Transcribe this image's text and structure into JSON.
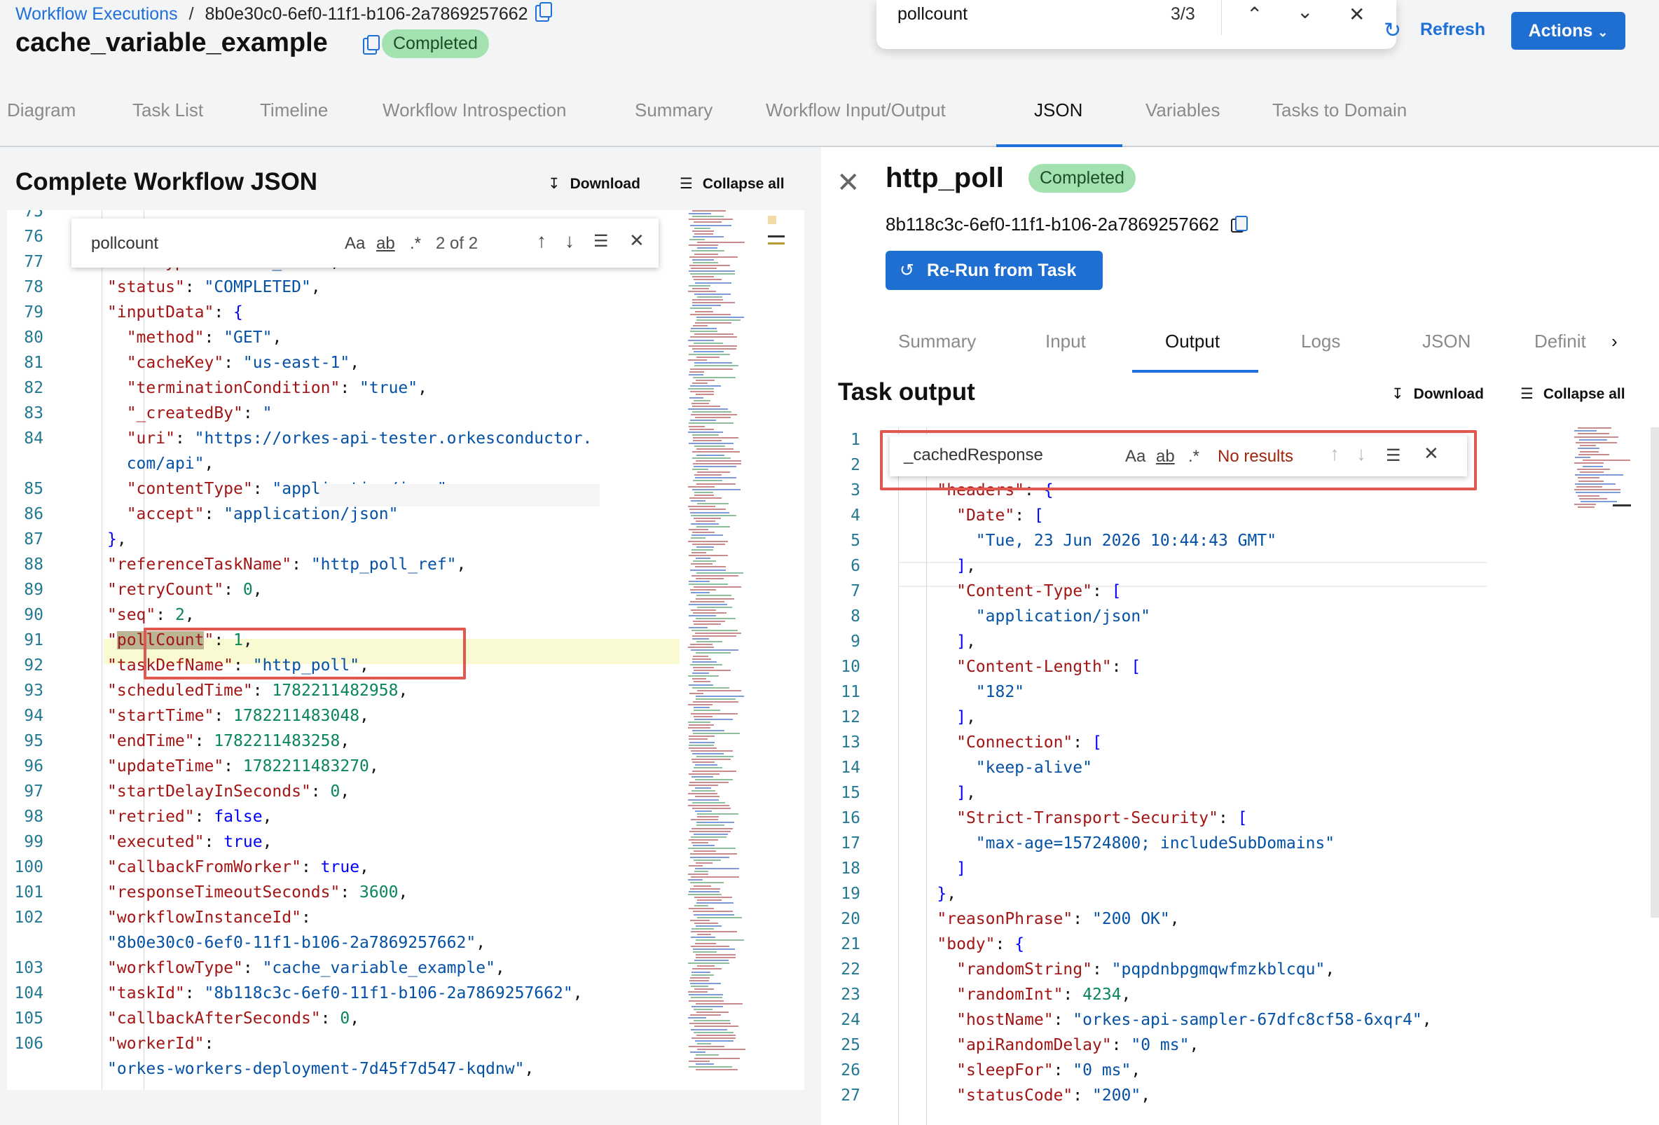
{
  "breadcrumb": {
    "root": "Workflow Executions",
    "separator": "/",
    "execution_id": "8b0e30c0-6ef0-11f1-b106-2a7869257662"
  },
  "workflow": {
    "name": "cache_variable_example",
    "status": "Completed"
  },
  "browser_find": {
    "query": "pollcount",
    "count": "3/3"
  },
  "header_actions": {
    "refresh": "Refresh",
    "actions": "Actions"
  },
  "tabs": [
    "Diagram",
    "Task List",
    "Timeline",
    "Workflow Introspection",
    "Summary",
    "Workflow Input/Output",
    "JSON",
    "Variables",
    "Tasks to Domain"
  ],
  "active_tab": "JSON",
  "left": {
    "title": "Complete Workflow JSON",
    "download": "Download",
    "collapse": "Collapse all",
    "find": {
      "query": "pollcount",
      "count": "2 of 2",
      "match_case": "Aa",
      "whole_word": "ab",
      "regex": ".*"
    },
    "lines": [
      {
        "no": "75",
        "tokens": []
      },
      {
        "no": "76",
        "tokens": []
      },
      {
        "no": "77",
        "tokens": [
          [
            "k",
            "\"taskType\""
          ],
          [
            "p",
            ": "
          ],
          [
            "s",
            "\"HTTP_POLL\""
          ],
          [
            "p",
            ","
          ]
        ]
      },
      {
        "no": "78",
        "tokens": [
          [
            "k",
            "\"status\""
          ],
          [
            "p",
            ": "
          ],
          [
            "s",
            "\"COMPLETED\""
          ],
          [
            "p",
            ","
          ]
        ]
      },
      {
        "no": "79",
        "tokens": [
          [
            "k",
            "\"inputData\""
          ],
          [
            "p",
            ": "
          ],
          [
            "b",
            "{"
          ]
        ]
      },
      {
        "no": "80",
        "tokens": [
          [
            "p",
            "  "
          ],
          [
            "k",
            "\"method\""
          ],
          [
            "p",
            ": "
          ],
          [
            "s",
            "\"GET\""
          ],
          [
            "p",
            ","
          ]
        ]
      },
      {
        "no": "81",
        "tokens": [
          [
            "p",
            "  "
          ],
          [
            "k",
            "\"cacheKey\""
          ],
          [
            "p",
            ": "
          ],
          [
            "s",
            "\"us-east-1\""
          ],
          [
            "p",
            ","
          ]
        ]
      },
      {
        "no": "82",
        "tokens": [
          [
            "p",
            "  "
          ],
          [
            "k",
            "\"terminationCondition\""
          ],
          [
            "p",
            ": "
          ],
          [
            "s",
            "\"true\""
          ],
          [
            "p",
            ","
          ]
        ]
      },
      {
        "no": "83",
        "tokens": [
          [
            "p",
            "  "
          ],
          [
            "k",
            "\"_createdBy\""
          ],
          [
            "p",
            ": "
          ],
          [
            "s",
            "\""
          ]
        ]
      },
      {
        "no": "84",
        "tokens": [
          [
            "p",
            "  "
          ],
          [
            "k",
            "\"uri\""
          ],
          [
            "p",
            ": "
          ],
          [
            "s",
            "\"https://orkes-api-tester.orkesconductor."
          ]
        ]
      },
      {
        "no": "",
        "tokens": [
          [
            "p",
            "  "
          ],
          [
            "s",
            "com/api\""
          ],
          [
            "p",
            ","
          ]
        ]
      },
      {
        "no": "85",
        "tokens": [
          [
            "p",
            "  "
          ],
          [
            "k",
            "\"contentType\""
          ],
          [
            "p",
            ": "
          ],
          [
            "s",
            "\"application/json\""
          ],
          [
            "p",
            ","
          ]
        ]
      },
      {
        "no": "86",
        "tokens": [
          [
            "p",
            "  "
          ],
          [
            "k",
            "\"accept\""
          ],
          [
            "p",
            ": "
          ],
          [
            "s",
            "\"application/json\""
          ]
        ]
      },
      {
        "no": "87",
        "tokens": [
          [
            "b",
            "}"
          ],
          [
            "p",
            ","
          ]
        ]
      },
      {
        "no": "88",
        "tokens": [
          [
            "k",
            "\"referenceTaskName\""
          ],
          [
            "p",
            ": "
          ],
          [
            "s",
            "\"http_poll_ref\""
          ],
          [
            "p",
            ","
          ]
        ]
      },
      {
        "no": "89",
        "tokens": [
          [
            "k",
            "\"retryCount\""
          ],
          [
            "p",
            ": "
          ],
          [
            "n",
            "0"
          ],
          [
            "p",
            ","
          ]
        ]
      },
      {
        "no": "90",
        "tokens": [
          [
            "k",
            "\"seq\""
          ],
          [
            "p",
            ": "
          ],
          [
            "n",
            "2"
          ],
          [
            "p",
            ","
          ]
        ]
      },
      {
        "no": "91",
        "tokens": [
          [
            "k",
            "\""
          ],
          [
            "m",
            "pollCount"
          ],
          [
            "k",
            "\""
          ],
          [
            "p",
            ": "
          ],
          [
            "n",
            "1"
          ],
          [
            "p",
            ","
          ]
        ]
      },
      {
        "no": "92",
        "tokens": [
          [
            "k",
            "\"taskDefName\""
          ],
          [
            "p",
            ": "
          ],
          [
            "s",
            "\"http_poll\""
          ],
          [
            "p",
            ","
          ]
        ]
      },
      {
        "no": "93",
        "tokens": [
          [
            "k",
            "\"scheduledTime\""
          ],
          [
            "p",
            ": "
          ],
          [
            "n",
            "1782211482958"
          ],
          [
            "p",
            ","
          ]
        ]
      },
      {
        "no": "94",
        "tokens": [
          [
            "k",
            "\"startTime\""
          ],
          [
            "p",
            ": "
          ],
          [
            "n",
            "1782211483048"
          ],
          [
            "p",
            ","
          ]
        ]
      },
      {
        "no": "95",
        "tokens": [
          [
            "k",
            "\"endTime\""
          ],
          [
            "p",
            ": "
          ],
          [
            "n",
            "1782211483258"
          ],
          [
            "p",
            ","
          ]
        ]
      },
      {
        "no": "96",
        "tokens": [
          [
            "k",
            "\"updateTime\""
          ],
          [
            "p",
            ": "
          ],
          [
            "n",
            "1782211483270"
          ],
          [
            "p",
            ","
          ]
        ]
      },
      {
        "no": "97",
        "tokens": [
          [
            "k",
            "\"startDelayInSeconds\""
          ],
          [
            "p",
            ": "
          ],
          [
            "n",
            "0"
          ],
          [
            "p",
            ","
          ]
        ]
      },
      {
        "no": "98",
        "tokens": [
          [
            "k",
            "\"retried\""
          ],
          [
            "p",
            ": "
          ],
          [
            "b",
            "false"
          ],
          [
            "p",
            ","
          ]
        ]
      },
      {
        "no": "99",
        "tokens": [
          [
            "k",
            "\"executed\""
          ],
          [
            "p",
            ": "
          ],
          [
            "b",
            "true"
          ],
          [
            "p",
            ","
          ]
        ]
      },
      {
        "no": "100",
        "tokens": [
          [
            "k",
            "\"callbackFromWorker\""
          ],
          [
            "p",
            ": "
          ],
          [
            "b",
            "true"
          ],
          [
            "p",
            ","
          ]
        ]
      },
      {
        "no": "101",
        "tokens": [
          [
            "k",
            "\"responseTimeoutSeconds\""
          ],
          [
            "p",
            ": "
          ],
          [
            "n",
            "3600"
          ],
          [
            "p",
            ","
          ]
        ]
      },
      {
        "no": "102",
        "tokens": [
          [
            "k",
            "\"workflowInstanceId\""
          ],
          [
            "p",
            ":"
          ]
        ]
      },
      {
        "no": "",
        "tokens": [
          [
            "s",
            "\"8b0e30c0-6ef0-11f1-b106-2a7869257662\""
          ],
          [
            "p",
            ","
          ]
        ]
      },
      {
        "no": "103",
        "tokens": [
          [
            "k",
            "\"workflowType\""
          ],
          [
            "p",
            ": "
          ],
          [
            "s",
            "\"cache_variable_example\""
          ],
          [
            "p",
            ","
          ]
        ]
      },
      {
        "no": "104",
        "tokens": [
          [
            "k",
            "\"taskId\""
          ],
          [
            "p",
            ": "
          ],
          [
            "s",
            "\"8b118c3c-6ef0-11f1-b106-2a7869257662\""
          ],
          [
            "p",
            ","
          ]
        ]
      },
      {
        "no": "105",
        "tokens": [
          [
            "k",
            "\"callbackAfterSeconds\""
          ],
          [
            "p",
            ": "
          ],
          [
            "n",
            "0"
          ],
          [
            "p",
            ","
          ]
        ]
      },
      {
        "no": "106",
        "tokens": [
          [
            "k",
            "\"workerId\""
          ],
          [
            "p",
            ":"
          ]
        ]
      },
      {
        "no": "",
        "tokens": [
          [
            "s",
            "\"orkes-workers-deployment-7d45f7d547-kqdnw\""
          ],
          [
            "p",
            ","
          ]
        ]
      }
    ]
  },
  "right": {
    "task_name": "http_poll",
    "status": "Completed",
    "task_id": "8b118c3c-6ef0-11f1-b106-2a7869257662",
    "rerun": "Re-Run from Task",
    "subtabs": [
      "Summary",
      "Input",
      "Output",
      "Logs",
      "JSON",
      "Definit"
    ],
    "active_subtab": "Output",
    "heading": "Task output",
    "download": "Download",
    "collapse": "Collapse all",
    "find": {
      "query": "_cachedResponse",
      "result": "No results",
      "match_case": "Aa",
      "whole_word": "ab",
      "regex": ".*"
    },
    "lines": [
      {
        "no": "1",
        "tokens": []
      },
      {
        "no": "2",
        "tokens": []
      },
      {
        "no": "3",
        "tokens": [
          [
            "p",
            "    "
          ],
          [
            "k",
            "\"headers\""
          ],
          [
            "p",
            ": "
          ],
          [
            "b",
            "{"
          ]
        ]
      },
      {
        "no": "4",
        "tokens": [
          [
            "p",
            "      "
          ],
          [
            "k",
            "\"Date\""
          ],
          [
            "p",
            ": "
          ],
          [
            "b",
            "["
          ]
        ]
      },
      {
        "no": "5",
        "tokens": [
          [
            "p",
            "        "
          ],
          [
            "s",
            "\"Tue, 23 Jun 2026 10:44:43 GMT\""
          ]
        ]
      },
      {
        "no": "6",
        "tokens": [
          [
            "p",
            "      "
          ],
          [
            "b",
            "]"
          ],
          [
            "p",
            ","
          ]
        ]
      },
      {
        "no": "7",
        "tokens": [
          [
            "p",
            "      "
          ],
          [
            "k",
            "\"Content-Type\""
          ],
          [
            "p",
            ": "
          ],
          [
            "b",
            "["
          ]
        ]
      },
      {
        "no": "8",
        "tokens": [
          [
            "p",
            "        "
          ],
          [
            "s",
            "\"application/json\""
          ]
        ]
      },
      {
        "no": "9",
        "tokens": [
          [
            "p",
            "      "
          ],
          [
            "b",
            "]"
          ],
          [
            "p",
            ","
          ]
        ]
      },
      {
        "no": "10",
        "tokens": [
          [
            "p",
            "      "
          ],
          [
            "k",
            "\"Content-Length\""
          ],
          [
            "p",
            ": "
          ],
          [
            "b",
            "["
          ]
        ]
      },
      {
        "no": "11",
        "tokens": [
          [
            "p",
            "        "
          ],
          [
            "s",
            "\"182\""
          ]
        ]
      },
      {
        "no": "12",
        "tokens": [
          [
            "p",
            "      "
          ],
          [
            "b",
            "]"
          ],
          [
            "p",
            ","
          ]
        ]
      },
      {
        "no": "13",
        "tokens": [
          [
            "p",
            "      "
          ],
          [
            "k",
            "\"Connection\""
          ],
          [
            "p",
            ": "
          ],
          [
            "b",
            "["
          ]
        ]
      },
      {
        "no": "14",
        "tokens": [
          [
            "p",
            "        "
          ],
          [
            "s",
            "\"keep-alive\""
          ]
        ]
      },
      {
        "no": "15",
        "tokens": [
          [
            "p",
            "      "
          ],
          [
            "b",
            "]"
          ],
          [
            "p",
            ","
          ]
        ]
      },
      {
        "no": "16",
        "tokens": [
          [
            "p",
            "      "
          ],
          [
            "k",
            "\"Strict-Transport-Security\""
          ],
          [
            "p",
            ": "
          ],
          [
            "b",
            "["
          ]
        ]
      },
      {
        "no": "17",
        "tokens": [
          [
            "p",
            "        "
          ],
          [
            "s",
            "\"max-age=15724800; includeSubDomains\""
          ]
        ]
      },
      {
        "no": "18",
        "tokens": [
          [
            "p",
            "      "
          ],
          [
            "b",
            "]"
          ]
        ]
      },
      {
        "no": "19",
        "tokens": [
          [
            "p",
            "    "
          ],
          [
            "b",
            "}"
          ],
          [
            "p",
            ","
          ]
        ]
      },
      {
        "no": "20",
        "tokens": [
          [
            "p",
            "    "
          ],
          [
            "k",
            "\"reasonPhrase\""
          ],
          [
            "p",
            ": "
          ],
          [
            "s",
            "\"200 OK\""
          ],
          [
            "p",
            ","
          ]
        ]
      },
      {
        "no": "21",
        "tokens": [
          [
            "p",
            "    "
          ],
          [
            "k",
            "\"body\""
          ],
          [
            "p",
            ": "
          ],
          [
            "b",
            "{"
          ]
        ]
      },
      {
        "no": "22",
        "tokens": [
          [
            "p",
            "      "
          ],
          [
            "k",
            "\"randomString\""
          ],
          [
            "p",
            ": "
          ],
          [
            "s",
            "\"pqpdnbpgmqwfmzkblcqu\""
          ],
          [
            "p",
            ","
          ]
        ]
      },
      {
        "no": "23",
        "tokens": [
          [
            "p",
            "      "
          ],
          [
            "k",
            "\"randomInt\""
          ],
          [
            "p",
            ": "
          ],
          [
            "n",
            "4234"
          ],
          [
            "p",
            ","
          ]
        ]
      },
      {
        "no": "24",
        "tokens": [
          [
            "p",
            "      "
          ],
          [
            "k",
            "\"hostName\""
          ],
          [
            "p",
            ": "
          ],
          [
            "s",
            "\"orkes-api-sampler-67dfc8cf58-6xqr4\""
          ],
          [
            "p",
            ","
          ]
        ]
      },
      {
        "no": "25",
        "tokens": [
          [
            "p",
            "      "
          ],
          [
            "k",
            "\"apiRandomDelay\""
          ],
          [
            "p",
            ": "
          ],
          [
            "s",
            "\"0 ms\""
          ],
          [
            "p",
            ","
          ]
        ]
      },
      {
        "no": "26",
        "tokens": [
          [
            "p",
            "      "
          ],
          [
            "k",
            "\"sleepFor\""
          ],
          [
            "p",
            ": "
          ],
          [
            "s",
            "\"0 ms\""
          ],
          [
            "p",
            ","
          ]
        ]
      },
      {
        "no": "27",
        "tokens": [
          [
            "p",
            "      "
          ],
          [
            "k",
            "\"statusCode\""
          ],
          [
            "p",
            ": "
          ],
          [
            "s",
            "\"200\""
          ],
          [
            "p",
            ","
          ]
        ]
      }
    ]
  },
  "colors": {
    "accent": "#1e6fd9",
    "badge_bg": "#a3e2b0",
    "highlight_box": "#e0574f",
    "json_key": "#a31515",
    "json_string": "#0451a5",
    "json_number": "#098658"
  }
}
